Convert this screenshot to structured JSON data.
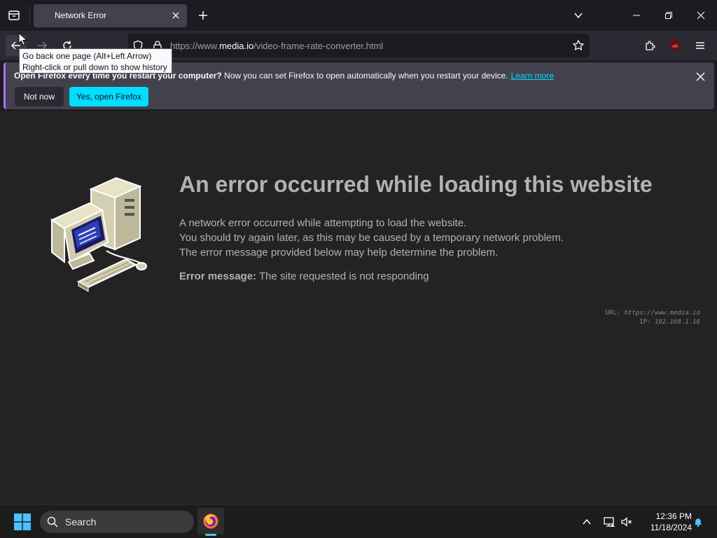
{
  "window": {
    "tab_title": "Network Error"
  },
  "navbar": {
    "url_prefix": "https://www.",
    "url_host": "media.io",
    "url_path": "/video-frame-rate-converter.html"
  },
  "tooltip": {
    "line1": "Go back one page (Alt+Left Arrow)",
    "line2": "Right-click or pull down to show history"
  },
  "notification": {
    "title": "Open Firefox every time you restart your computer?",
    "message": "Now you can set Firefox to open automatically when you restart your device.",
    "link": "Learn more",
    "not_now": "Not now",
    "yes": "Yes, open Firefox"
  },
  "error_page": {
    "title": "An error occurred while loading this website",
    "line1": "A network error occurred while attempting to load the website.",
    "line2": "You should try again later, as this may be caused by a temporary network problem.",
    "line3": "The error message provided below may help determine the problem.",
    "error_label": "Error message:",
    "error_value": "The site requested is not responding",
    "url_label": "URL:",
    "url_value": "https://www.media.io",
    "ip_label": "IP:",
    "ip_value": "192.168.1.16"
  },
  "taskbar": {
    "search_label": "Search",
    "time": "12:36 PM",
    "date": "11/18/2024"
  },
  "colors": {
    "accent": "#00ddff",
    "page_bg": "#232323",
    "chrome_bg": "#1c1b22",
    "notification_bg": "#42414d"
  }
}
